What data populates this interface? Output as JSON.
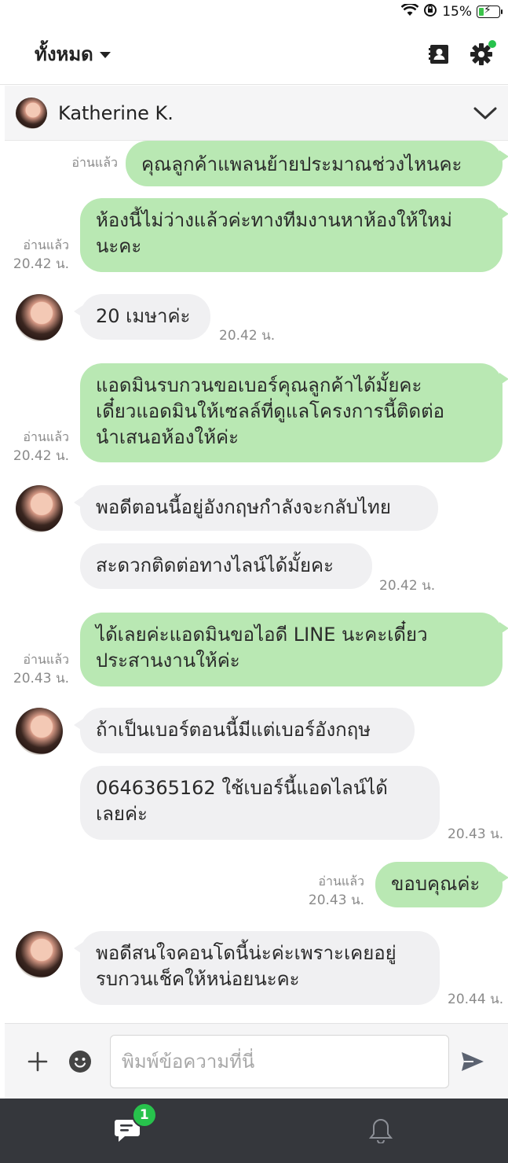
{
  "status_bar": {
    "battery_text": "15%",
    "battery_level": 0.15
  },
  "header": {
    "filter_label": "ทั้งหมด"
  },
  "chat": {
    "contact_name": "Katherine K."
  },
  "messages": [
    {
      "dir": "out",
      "text": "คุณลูกค้าแพลนย้ายประมาณช่วงไหนคะ",
      "read": "อ่านแล้ว",
      "time": ""
    },
    {
      "dir": "out",
      "text": "ห้องนี้ไม่ว่างแล้วค่ะทางทีมงานหาห้องให้ใหม่\nนะคะ",
      "read": "อ่านแล้ว",
      "time": "20.42 น."
    },
    {
      "dir": "in",
      "text": "20 เมษาค่ะ",
      "time": "20.42 น."
    },
    {
      "dir": "out",
      "text": "แอดมินรบกวนขอเบอร์คุณลูกค้าได้มั้ยคะ\nเดี๋ยวแอดมินให้เซลล์ที่ดูแลโครงการนี้ติดต่อ\nนำเสนอห้องให้ค่ะ",
      "read": "อ่านแล้ว",
      "time": "20.42 น."
    },
    {
      "dir": "in",
      "text": "พอดีตอนนี้อยู่อังกฤษกำลังจะกลับไทย",
      "time": ""
    },
    {
      "dir": "in",
      "text": "สะดวกติดต่อทางไลน์ได้มั้ยคะ",
      "time": "20.42 น."
    },
    {
      "dir": "out",
      "text": "ได้เลยค่ะแอดมินขอไอดี LINE นะคะเดี๋ยว\nประสานงานให้ค่ะ",
      "read": "อ่านแล้ว",
      "time": "20.43 น."
    },
    {
      "dir": "in",
      "text": "ถ้าเป็นเบอร์ตอนนี้มีแต่เบอร์อังกฤษ",
      "time": ""
    },
    {
      "dir": "in",
      "text": "0646365162 ใช้เบอร์นี้แอดไลน์ได้\nเลยค่ะ",
      "time": "20.43 น."
    },
    {
      "dir": "out",
      "text": "ขอบคุณค่ะ",
      "read": "อ่านแล้ว",
      "time": "20.43 น."
    },
    {
      "dir": "in",
      "text": "พอดีสนใจคอนโดนี้น่ะค่ะเพราะเคยอยู่\nรบกวนเช็คให้หน่อยนะคะ",
      "time": "20.44 น."
    }
  ],
  "composer": {
    "placeholder": "พิมพ์ข้อความที่นี่"
  },
  "bottom_nav": {
    "chat_badge": "1"
  },
  "colors": {
    "outgoing_bubble": "#b9e8b3",
    "incoming_bubble": "#f0f0f2",
    "accent_green": "#27c24c",
    "nav_bg": "#35373c"
  }
}
